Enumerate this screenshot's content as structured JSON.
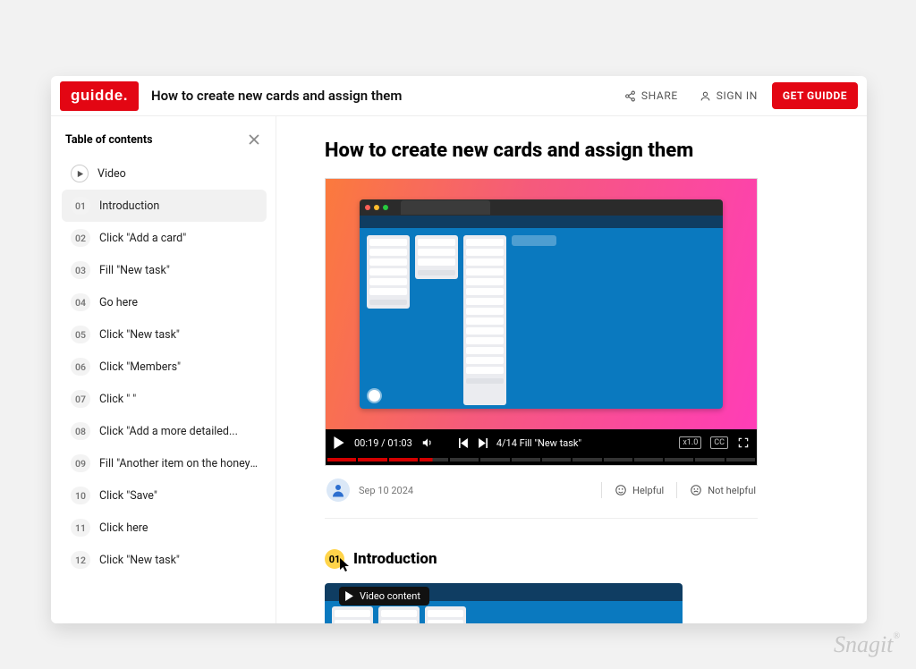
{
  "brand": "guidde.",
  "header": {
    "title": "How to create new cards and assign them",
    "share": "SHARE",
    "signin": "SIGN IN",
    "get_guidde": "GET GUIDDE"
  },
  "sidebar": {
    "title": "Table of contents",
    "video_label": "Video",
    "items": [
      {
        "num": "01",
        "label": "Introduction",
        "active": true
      },
      {
        "num": "02",
        "label": "Click \"Add a card\""
      },
      {
        "num": "03",
        "label": "Fill \"New task\""
      },
      {
        "num": "04",
        "label": "Go here"
      },
      {
        "num": "05",
        "label": "Click \"New task\""
      },
      {
        "num": "06",
        "label": "Click \"Members\""
      },
      {
        "num": "07",
        "label": "Click \"                     \""
      },
      {
        "num": "08",
        "label": "Click \"Add a more detailed..."
      },
      {
        "num": "09",
        "label": "Fill \"Another item on the honey-..."
      },
      {
        "num": "10",
        "label": "Click \"Save\""
      },
      {
        "num": "11",
        "label": "Click here"
      },
      {
        "num": "12",
        "label": "Click \"New task\""
      }
    ]
  },
  "main": {
    "title": "How to create new cards and assign them",
    "video": {
      "time_current": "00:19",
      "time_total": "01:03",
      "step_label": "4/14 Fill \"New task\"",
      "speed": "x1.0",
      "cc": "CC",
      "segments_total": 14,
      "segments_done": 3,
      "current_segment_partial": true
    },
    "date": "Sep 10 2024",
    "helpful": "Helpful",
    "not_helpful": "Not helpful",
    "section": {
      "num": "01",
      "title": "Introduction",
      "chip": "Video content"
    }
  },
  "watermark": "Snagit"
}
